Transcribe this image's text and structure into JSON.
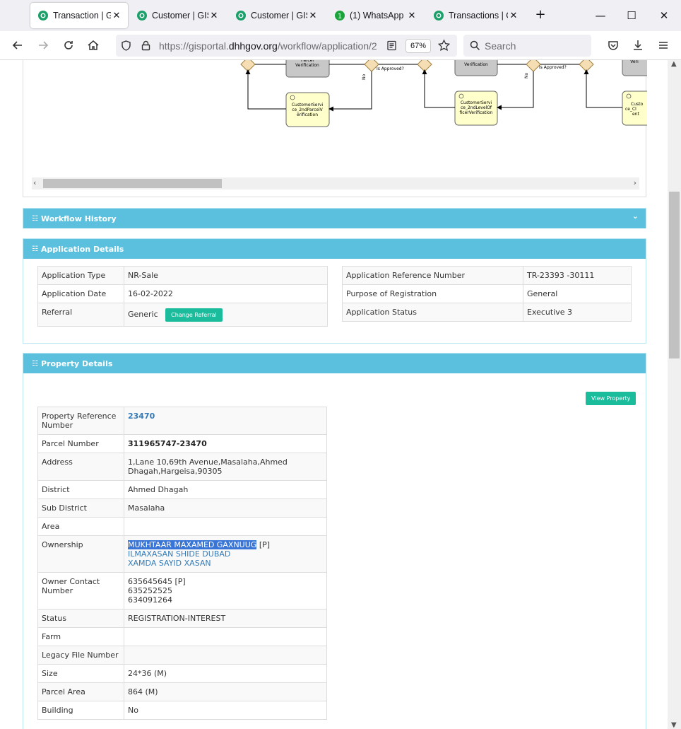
{
  "browser": {
    "tabs": [
      {
        "title": "Transaction | GIS Portal",
        "active": true
      },
      {
        "title": "Customer | GIS Portal",
        "active": false
      },
      {
        "title": "Customer | GIS Portal",
        "active": false
      },
      {
        "title": "(1) WhatsApp",
        "active": false,
        "badge": "1"
      },
      {
        "title": "Transactions | GIS Portal",
        "active": false
      }
    ],
    "url_prefix": "https://gisportal.",
    "url_domain": "dhhgov.org",
    "url_path": "/workflow/application/2",
    "zoom": "67%",
    "search_placeholder": "Search"
  },
  "diagram": {
    "labels": {
      "parcel_verification": "Parcel Verification",
      "verification_2": "Verification",
      "verif_3": "Veri",
      "is_approved": "Is Approved?",
      "no": "No",
      "cs_2nd_parcel": "CustomerService_2ndParcelVerification",
      "cs_2nd_level": "CustomerService_2ndLevelOfficerVerification",
      "cs_partial": "Custo ce_Cl ent"
    }
  },
  "workflow_history": {
    "title": "Workflow History"
  },
  "application_details": {
    "title": "Application Details",
    "left": [
      {
        "label": "Application Type",
        "value": "NR-Sale"
      },
      {
        "label": "Application Date",
        "value": "16-02-2022"
      },
      {
        "label": "Referral",
        "value": "Generic"
      }
    ],
    "change_referral_label": "Change Referral",
    "right": [
      {
        "label": "Application Reference Number",
        "value": "TR-23393 -30111"
      },
      {
        "label": "Purpose of Registration",
        "value": "General"
      },
      {
        "label": "Application Status",
        "value": "Executive 3"
      }
    ]
  },
  "property_details": {
    "title": "Property Details",
    "view_property_label": "View Property",
    "rows": {
      "ref_label": "Property Reference Number",
      "ref_value": "23470",
      "parcel_label": "Parcel Number",
      "parcel_value": "311965747-23470",
      "address_label": "Address",
      "address_line1": "1,Lane 10,69th Avenue,Masalaha,Ahmed",
      "address_line2": "Dhagah,Hargeisa,90305",
      "district_label": "District",
      "district_value": "Ahmed Dhagah",
      "subdistrict_label": "Sub District",
      "subdistrict_value": "Masalaha",
      "area_label": "Area",
      "ownership_label": "Ownership",
      "owner1": "MUKHTAAR MAXAMED GAXNUUG",
      "owner1_tag": "[P]",
      "owner2": "ILMAXASAN SHIDE DUBAD",
      "owner3": "XAMDA SAYID XASAN",
      "contact_label": "Owner Contact Number",
      "contact1": "635645645 [P]",
      "contact2": "635252525",
      "contact3": "634091264",
      "status_label": "Status",
      "status_value": "REGISTRATION-INTEREST",
      "farm_label": "Farm",
      "legacy_label": "Legacy File Number",
      "size_label": "Size",
      "size_value": "24*36 (M)",
      "parcel_area_label": "Parcel Area",
      "parcel_area_value": "864 (M)",
      "building_label": "Building",
      "building_value": "No"
    }
  },
  "colors": {
    "panel_header": "#5bc0de",
    "button_green": "#1abc9c",
    "link": "#337ab7",
    "selection": "#3875d7"
  }
}
